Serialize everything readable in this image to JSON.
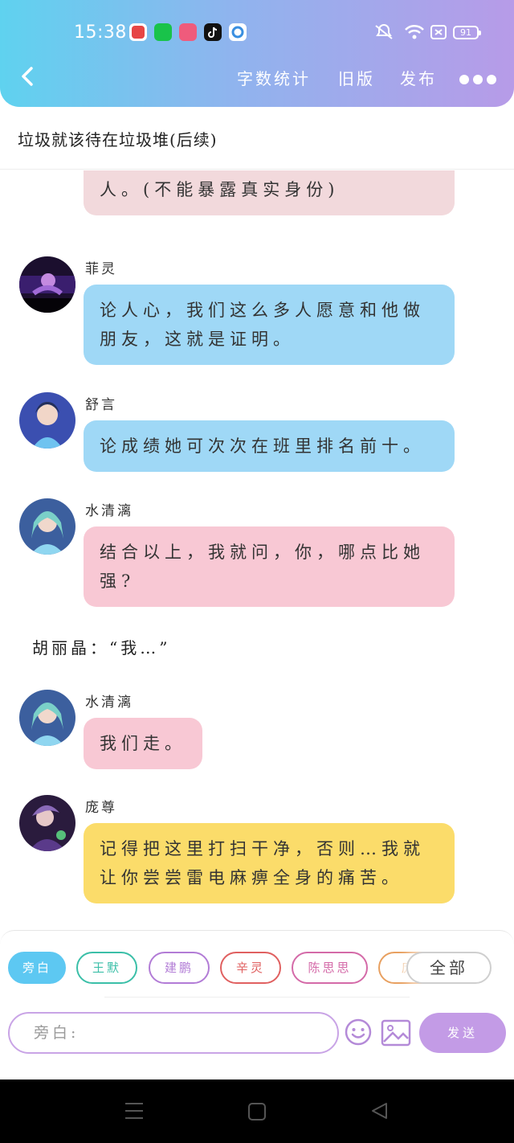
{
  "status_bar": {
    "time": "15:38",
    "battery": "91"
  },
  "nav": {
    "word_count": "字数统计",
    "preview": "旧版",
    "publish": "发布"
  },
  "story_title": "垃圾就该待在垃圾堆(后续)",
  "messages": [
    {
      "id": "m0",
      "speaker": "",
      "text": "不的叶罗丽武士，是罗丽公主的王人。(不能暴露真实身份)",
      "color": "#f2d9dc"
    },
    {
      "id": "m1",
      "speaker": "菲灵",
      "text": "论人心，我们这么多人愿意和他做朋友，这就是证明。",
      "color": "#9fd8f6"
    },
    {
      "id": "m2",
      "speaker": "舒言",
      "text": "论成绩她可次次在班里排名前十。",
      "color": "#9fd8f6"
    },
    {
      "id": "m3",
      "speaker": "水清漓",
      "text": "结合以上，我就问，你，哪点比她强?",
      "color": "#f8c8d4"
    },
    {
      "id": "n1",
      "narration": "胡丽晶：“我…”"
    },
    {
      "id": "m4",
      "speaker": "水清漓",
      "text": "我们走。",
      "color": "#f8c8d4"
    },
    {
      "id": "m5",
      "speaker": "庞尊",
      "text": "记得把这里打扫干净，否则…我就让你尝尝雷电麻痹全身的痛苦。",
      "color": "#fbdc6a"
    }
  ],
  "characters": [
    {
      "label": "旁白",
      "color": "#5dc8f2",
      "selected": true
    },
    {
      "label": "王默",
      "color": "#3bbfa8",
      "selected": false
    },
    {
      "label": "建鹏",
      "color": "#b27cd6",
      "selected": false
    },
    {
      "label": "辛灵",
      "color": "#e06060",
      "selected": false
    },
    {
      "label": "陈思思",
      "color": "#d46aa8",
      "selected": false
    },
    {
      "label": "庞",
      "color": "#e8a060",
      "selected": false
    }
  ],
  "chip_all": "全部",
  "input": {
    "placeholder": "旁白:"
  },
  "send_label": "发送"
}
